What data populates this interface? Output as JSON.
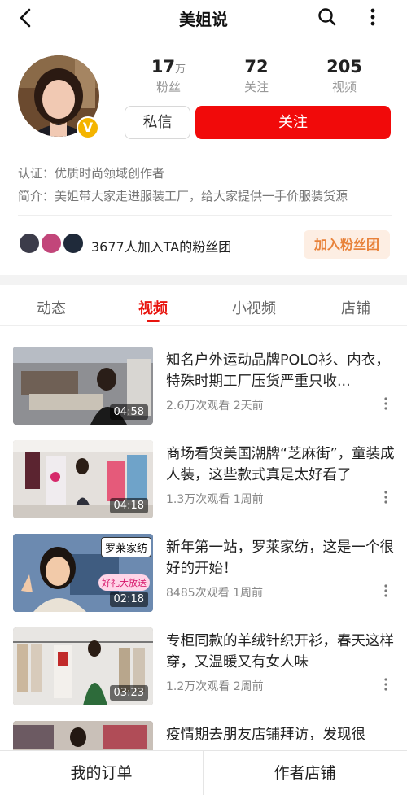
{
  "header": {
    "title": "美姐说"
  },
  "profile": {
    "stats": [
      {
        "number": "17",
        "unit": "万",
        "label": "粉丝"
      },
      {
        "number": "72",
        "unit": "",
        "label": "关注"
      },
      {
        "number": "205",
        "unit": "",
        "label": "视频"
      }
    ],
    "message_button": "私信",
    "follow_button": "关注",
    "certification": "认证：优质时尚领域创作者",
    "intro": "简介：美姐带大家走进服装工厂，给大家提供一手价服装货源",
    "badge": "V"
  },
  "fan_group": {
    "text": "3677人加入TA的粉丝团",
    "join_button": "加入粉丝团"
  },
  "tabs": [
    {
      "label": "动态",
      "active": false
    },
    {
      "label": "视频",
      "active": true
    },
    {
      "label": "小视频",
      "active": false
    },
    {
      "label": "店铺",
      "active": false
    }
  ],
  "videos": [
    {
      "title": "知名户外运动品牌POLO衫、内衣，特殊时期工厂压货严重只收...",
      "views": "2.6万次观看",
      "time": "2天前",
      "duration": "04:58"
    },
    {
      "title": "商场看货美国潮牌“芝麻街”，童装成人装，这些款式真是太好看了",
      "views": "1.3万次观看",
      "time": "1周前",
      "duration": "04:18"
    },
    {
      "title": "新年第一站，罗莱家纺，这是一个很好的开始！",
      "views": "8485次观看",
      "time": "1周前",
      "duration": "02:18",
      "overlay_top": "罗莱家纺",
      "overlay_bottom": "好礼大放送"
    },
    {
      "title": "专柜同款的羊绒针织开衫，春天这样穿，又温暖又有女人味",
      "views": "1.2万次观看",
      "time": "2周前",
      "duration": "03:23"
    },
    {
      "title": "疫情期去朋友店铺拜访，发现很",
      "views": "",
      "time": "",
      "duration": ""
    }
  ],
  "bottom_bar": {
    "orders": "我的订单",
    "shop": "作者店铺"
  },
  "colors": {
    "accent_red": "#f10a0a",
    "tab_red": "#e8140e",
    "join_bg": "#fdeee3",
    "join_text": "#e8823a",
    "badge_gold": "#f4b400"
  }
}
